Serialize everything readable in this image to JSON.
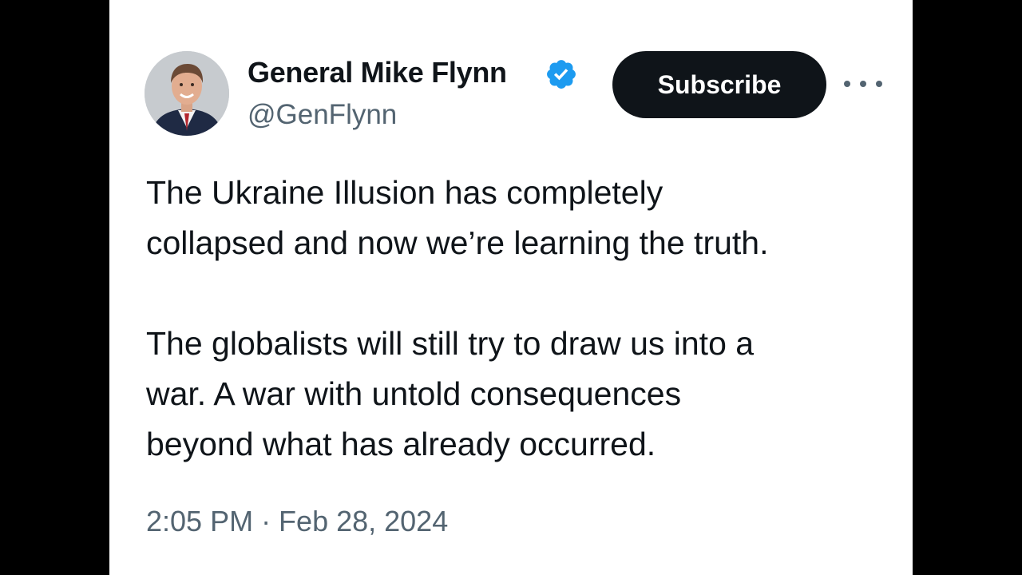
{
  "tweet": {
    "author": {
      "display_name": "General Mike Flynn",
      "handle": "@GenFlynn",
      "verified": true,
      "verified_icon": "verified-badge-icon",
      "verified_color": "#1d9bf0"
    },
    "subscribe_label": "Subscribe",
    "more_icon": "more-horizontal-icon",
    "paragraphs": [
      "The Ukraine Illusion has completely\ncollapsed and now we’re learning the truth.",
      "The globalists will still try to draw us into a\nwar. A war with untold consequences\nbeyond what has already occurred."
    ],
    "timestamp": "2:05 PM · Feb 28, 2024"
  },
  "colors": {
    "text_primary": "#0f1419",
    "text_secondary": "#536471",
    "button_bg": "#0f1419",
    "button_text": "#ffffff",
    "card_bg": "#ffffff",
    "letterbox": "#000000"
  }
}
